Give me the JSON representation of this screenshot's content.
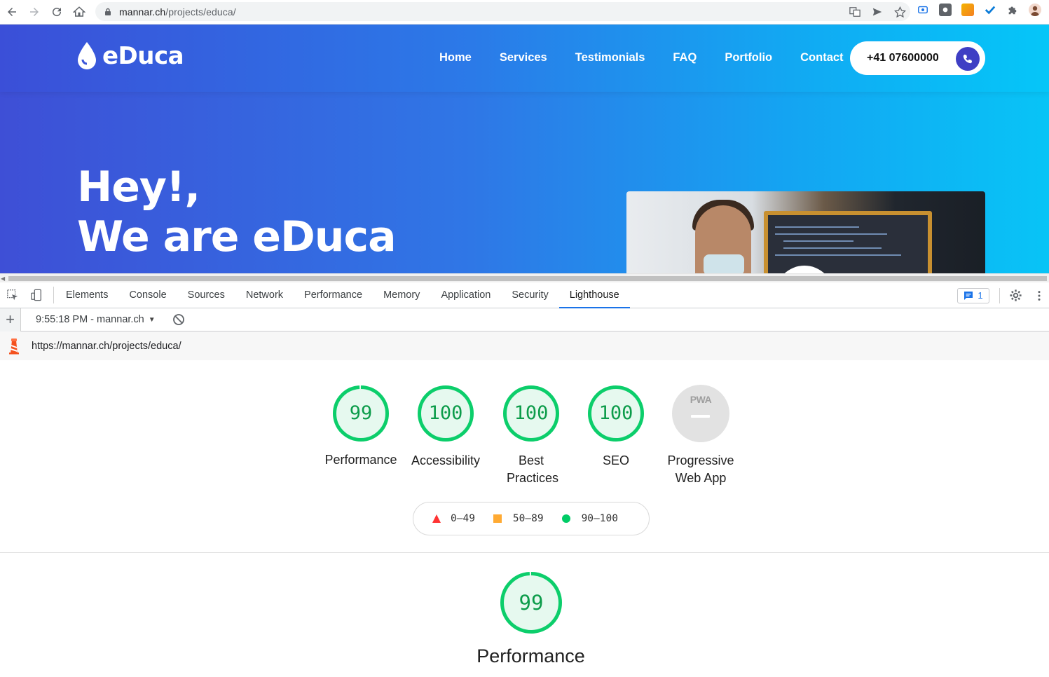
{
  "browser": {
    "url_host": "mannar.ch",
    "url_path": "/projects/educa/"
  },
  "site": {
    "logo_text": "eDuca",
    "nav": [
      "Home",
      "Services",
      "Testimonials",
      "FAQ",
      "Portfolio",
      "Contact"
    ],
    "phone": "+41 07600000",
    "hero_line1": "Hey!,",
    "hero_line2": "We are eDuca"
  },
  "devtools": {
    "tabs": [
      "Elements",
      "Console",
      "Sources",
      "Network",
      "Performance",
      "Memory",
      "Application",
      "Security",
      "Lighthouse"
    ],
    "active_tab": "Lighthouse",
    "issues_count": "1",
    "report_label": "9:55:18 PM - mannar.ch",
    "report_url": "https://mannar.ch/projects/educa/"
  },
  "lighthouse": {
    "categories": [
      {
        "label": "Performance",
        "score": "99",
        "fraction": 0.99
      },
      {
        "label": "Accessibility",
        "score": "100",
        "fraction": 1.0
      },
      {
        "label": "Best Practices",
        "score": "100",
        "fraction": 1.0
      },
      {
        "label": "SEO",
        "score": "100",
        "fraction": 1.0
      },
      {
        "label": "Progressive Web App",
        "score": "",
        "fraction": null
      }
    ],
    "pwa_badge": "PWA",
    "legend": [
      "0–49",
      "50–89",
      "90–100"
    ],
    "performance_section_score": "99",
    "performance_section_title": "Performance",
    "colors": {
      "pass": "#0cce6b",
      "average": "#ffa400",
      "fail": "#ff4e42",
      "pass_bg": "#e6f9ef"
    }
  }
}
